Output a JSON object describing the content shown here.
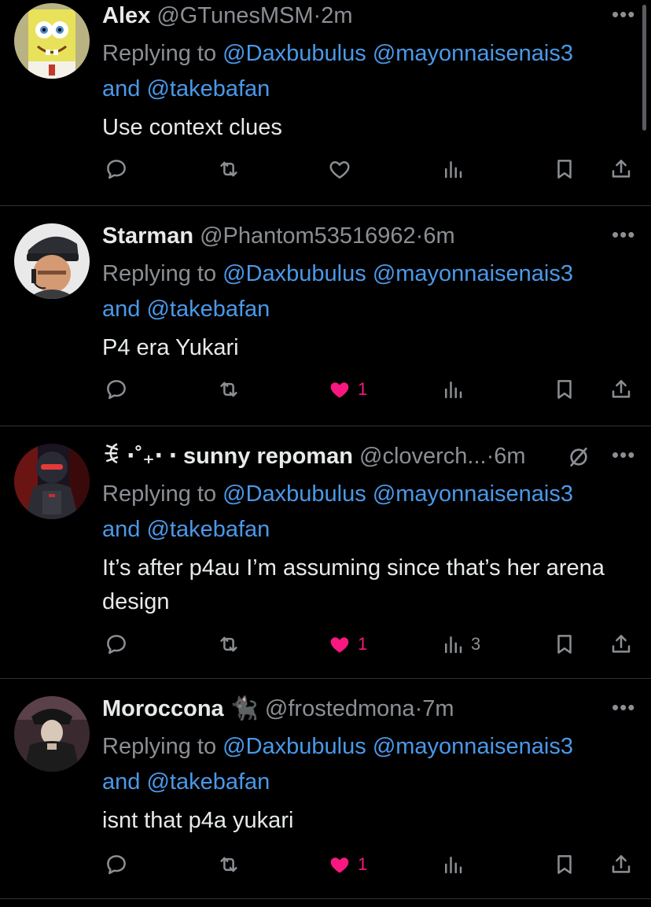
{
  "tweets": [
    {
      "name": "Alex",
      "handle": "@GTunesMSM",
      "time": "2m",
      "reply_prefix": "Replying to",
      "mention1": "@Daxbubulus",
      "mention2": "@mayonnaisenais3",
      "and_word": "and",
      "mention3": "@takebafan",
      "text": "Use context clues",
      "likes": "",
      "views": ""
    },
    {
      "name": "Starman",
      "handle": "@Phantom53516962",
      "time": "6m",
      "reply_prefix": "Replying to",
      "mention1": "@Daxbubulus",
      "mention2": "@mayonnaisenais3",
      "and_word": "and",
      "mention3": "@takebafan",
      "text": "P4 era Yukari",
      "likes": "1",
      "views": ""
    },
    {
      "name": "ꉂ ⋅˚₊‧ ‧ sunny repoman",
      "handle": "@cloverch...",
      "time": "6m",
      "reply_prefix": "Replying to",
      "mention1": "@Daxbubulus",
      "mention2": "@mayonnaisenais3",
      "and_word": "and",
      "mention3": "@takebafan",
      "text": "It’s after p4au I’m assuming since that’s her arena design",
      "likes": "1",
      "views": "3"
    },
    {
      "name": "Moroccona",
      "name_emoji": "🐈‍⬛",
      "handle": "@frostedmona",
      "time": "7m",
      "reply_prefix": "Replying to",
      "mention1": "@Daxbubulus",
      "mention2": "@mayonnaisenais3",
      "and_word": "and",
      "mention3": "@takebafan",
      "text": "isnt that p4a yukari",
      "likes": "1",
      "views": ""
    }
  ],
  "separator": "·",
  "more_glyph": "•••",
  "colors": {
    "background": "#000000",
    "text": "#e7e9ea",
    "muted": "#8b8f94",
    "link": "#4a99e9",
    "like": "#f91880",
    "divider": "#2f3336"
  },
  "icons": [
    "reply-icon",
    "retweet-icon",
    "like-icon",
    "views-icon",
    "bookmark-icon",
    "share-icon",
    "more-icon",
    "muted-icon"
  ]
}
